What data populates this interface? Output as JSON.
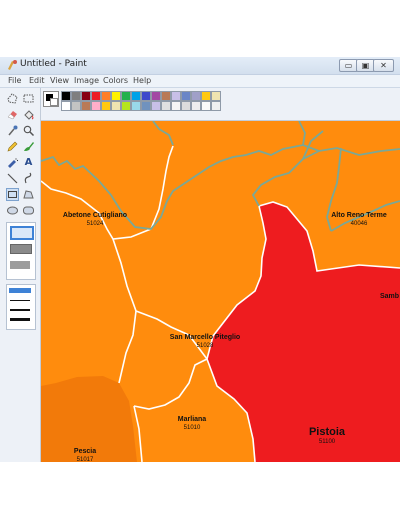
{
  "window": {
    "title": "Untitled - Paint"
  },
  "window_controls": {
    "minimize": "▭",
    "maximize": "▣",
    "close": "✕"
  },
  "menu": {
    "file": "File",
    "edit": "Edit",
    "view": "View",
    "image": "Image",
    "colors": "Colors",
    "help": "Help"
  },
  "tools": {
    "text_tool": "A"
  },
  "palette": {
    "primary": "#000000",
    "secondary": "#ffffff",
    "row1": [
      "#000000",
      "#7f7f7f",
      "#880015",
      "#ed1c24",
      "#ff7f27",
      "#fff200",
      "#22b14c",
      "#00a2e8",
      "#3f48cc",
      "#a349a4",
      "#b97a57",
      "#c8bfe7",
      "#6a86c7",
      "#a0a0c8",
      "#ffc90e",
      "#efe4b0"
    ],
    "row2": [
      "#ffffff",
      "#c3c3c3",
      "#b97a57",
      "#ffaec9",
      "#ffc90e",
      "#efe4b0",
      "#b5e61d",
      "#99d9ea",
      "#7092be",
      "#c8bfe7",
      "#e0e0e0",
      "#f5f5f5",
      "#dcdcdc",
      "#eeeeee",
      "#fafafa",
      "#f0f0f0"
    ]
  },
  "colors": {
    "orange_region": "#ff8c0d",
    "dark_orange_region": "#f27a0a",
    "red_region": "#ee1c1f",
    "border": "#7aa897",
    "border_white": "#ffffff"
  },
  "map": {
    "labels": [
      {
        "name": "Abetone Cutigliano",
        "code": "51024"
      },
      {
        "name": "Abetone Cutigliano",
        "code": ""
      },
      {
        "name": "Alto Reno Terme",
        "code": "40046"
      },
      {
        "name": "Samb",
        "code": ""
      },
      {
        "name": "San Marcello Piteglio",
        "code": "51028"
      },
      {
        "name": "Pistoia",
        "code": "51100"
      },
      {
        "name": "Marliana",
        "code": "51010"
      },
      {
        "name": "Pescia",
        "code": "51017"
      }
    ]
  }
}
